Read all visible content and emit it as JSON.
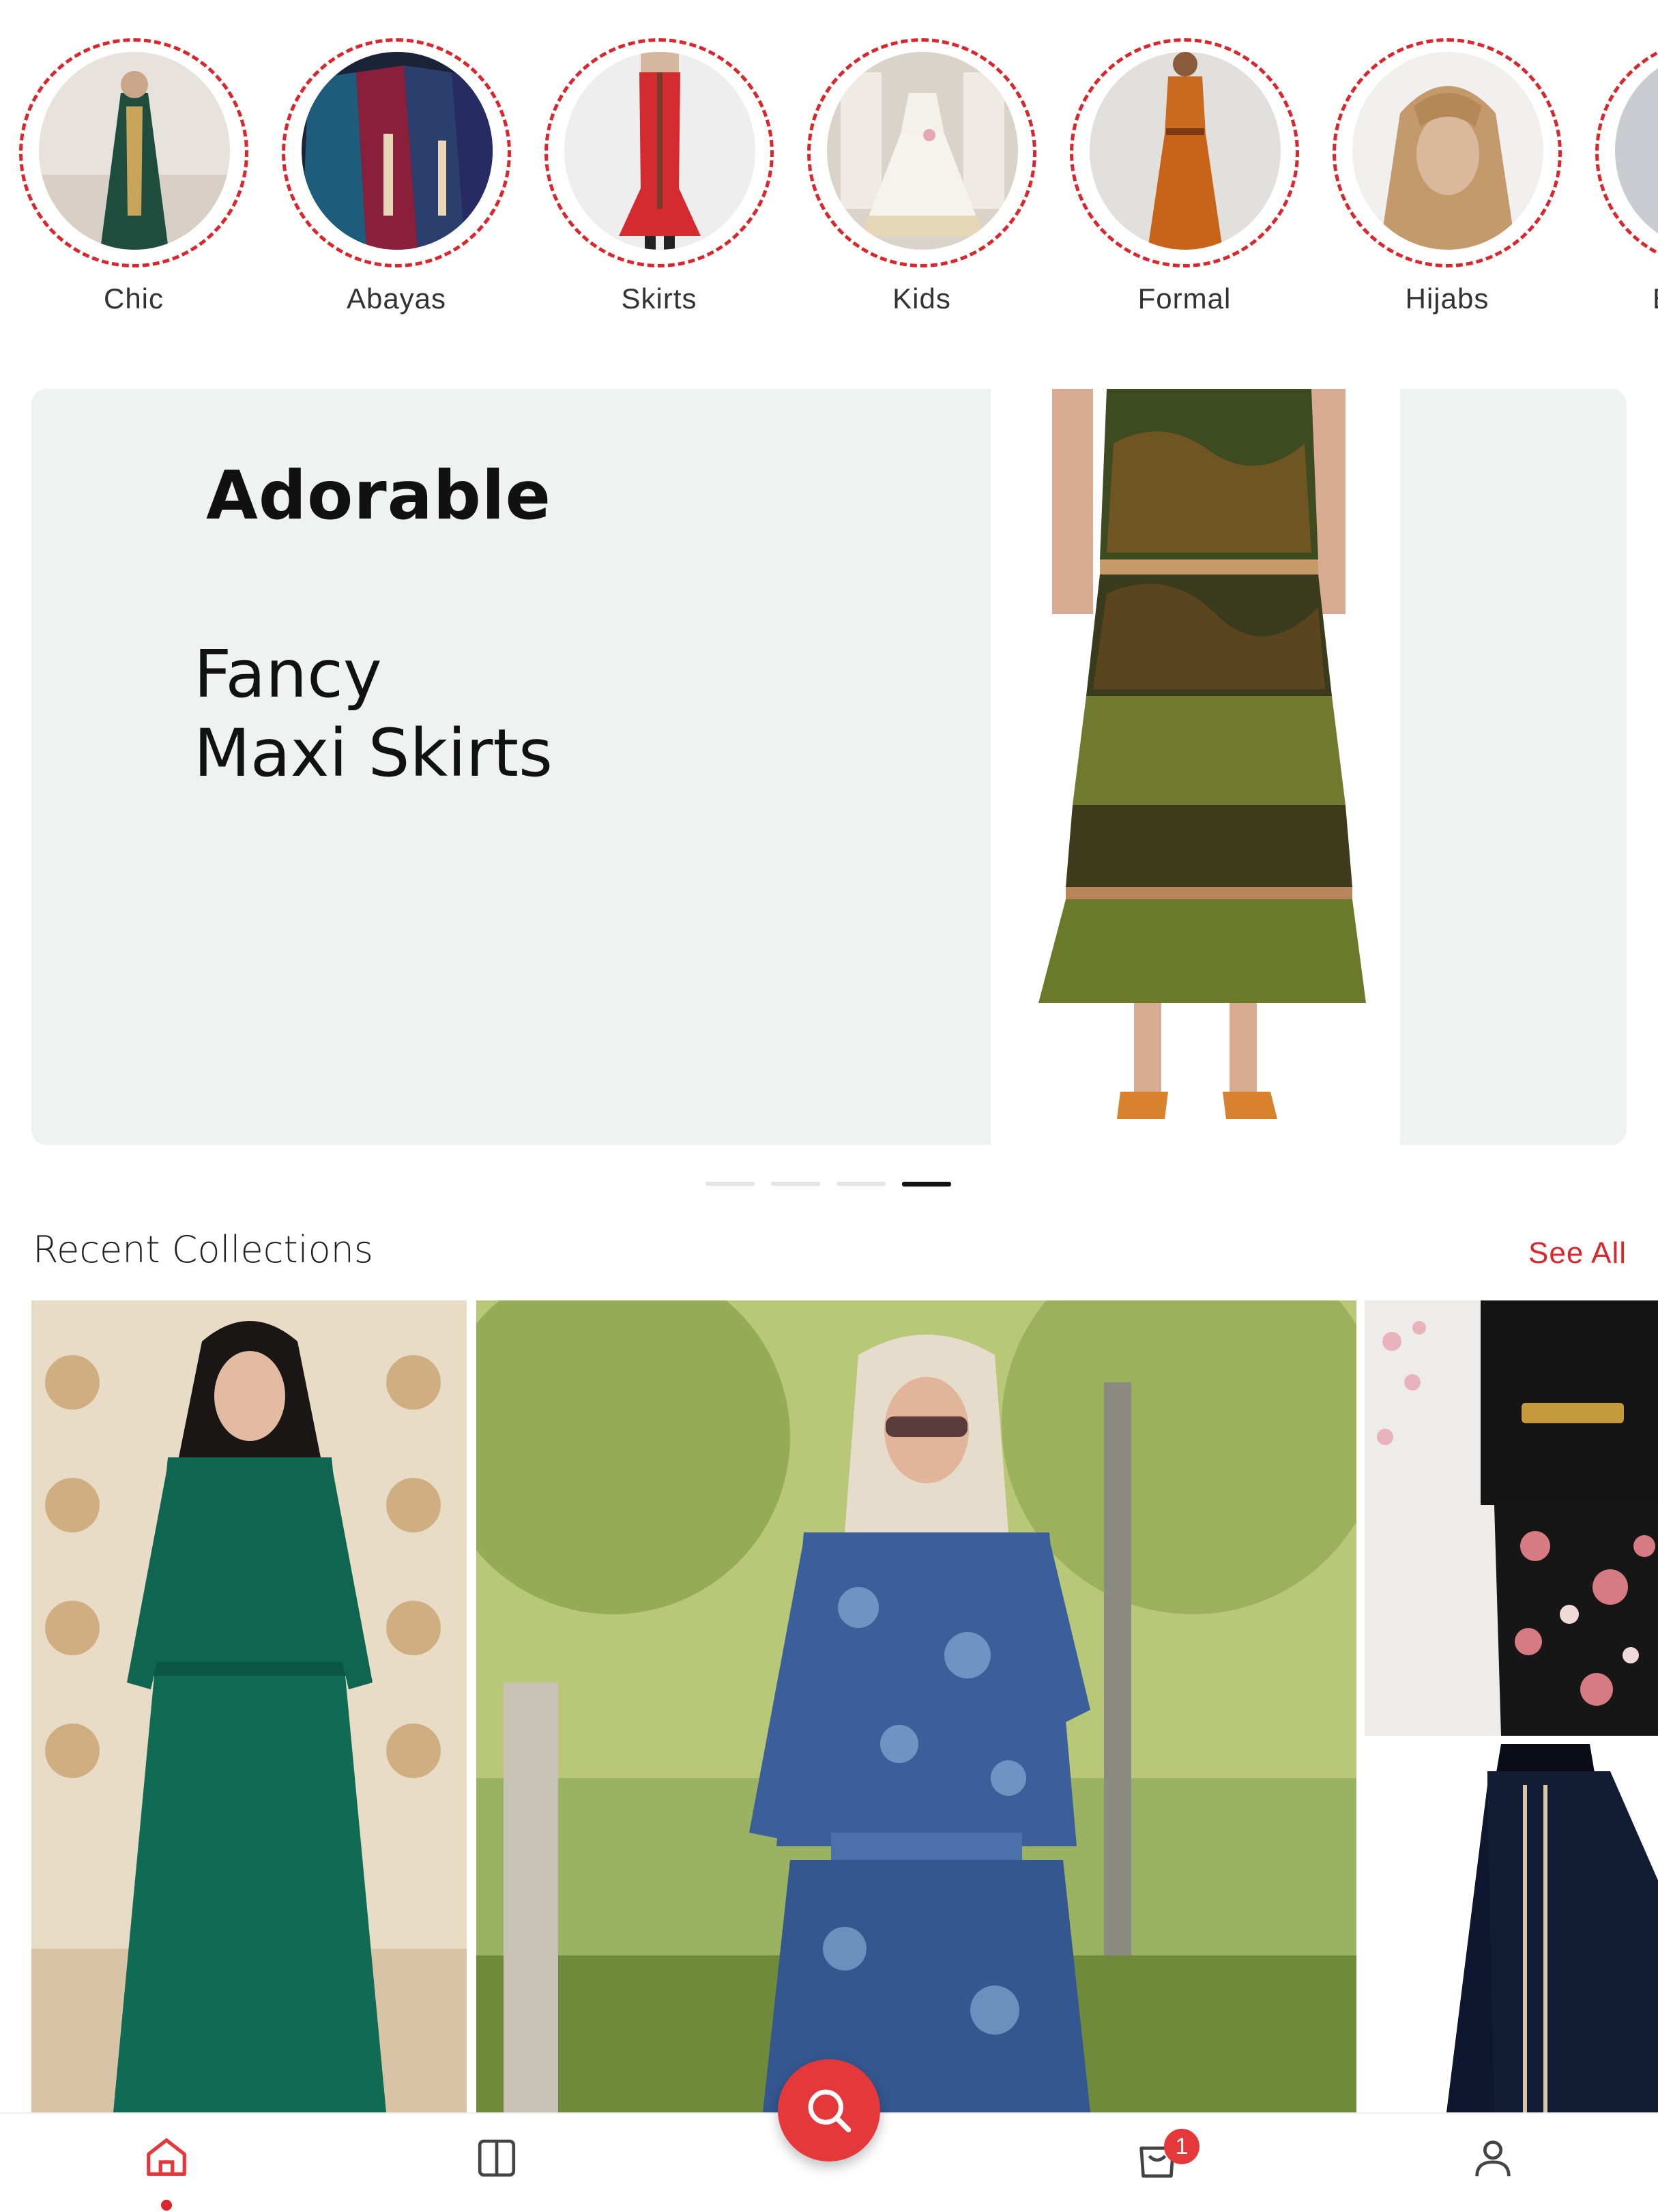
{
  "categories": [
    {
      "label": "Chic",
      "tone": "#1f4d3d"
    },
    {
      "label": "Abayas",
      "tone": "#2a3f6e"
    },
    {
      "label": "Skirts",
      "tone": "#d52a2f"
    },
    {
      "label": "Kids",
      "tone": "#f3efe7"
    },
    {
      "label": "Formal",
      "tone": "#c96a1e"
    },
    {
      "label": "Hijabs",
      "tone": "#c49a6c"
    },
    {
      "label": "B",
      "tone": "#b9bcc2"
    }
  ],
  "banner": {
    "heading": "Adorable",
    "subtitle_line1": "Fancy",
    "subtitle_line2": "Maxi Skirts",
    "slides_total": 4,
    "active_slide": 4
  },
  "collections": {
    "title": "Recent Collections",
    "see_all": "See All",
    "items": [
      {
        "name": "green-lace-dress"
      },
      {
        "name": "blue-floral-dress"
      },
      {
        "name": "black-jacket-floral-dress"
      },
      {
        "name": "navy-abaya"
      }
    ]
  },
  "bottom_nav": {
    "items": [
      "home-icon",
      "catalog-icon",
      "search-icon",
      "cart-icon",
      "profile-icon"
    ],
    "active": "home-icon",
    "cart_count": "1"
  },
  "colors": {
    "accent": "#d9272e",
    "fab": "#e5383b",
    "banner_bg": "#eff2f1"
  }
}
